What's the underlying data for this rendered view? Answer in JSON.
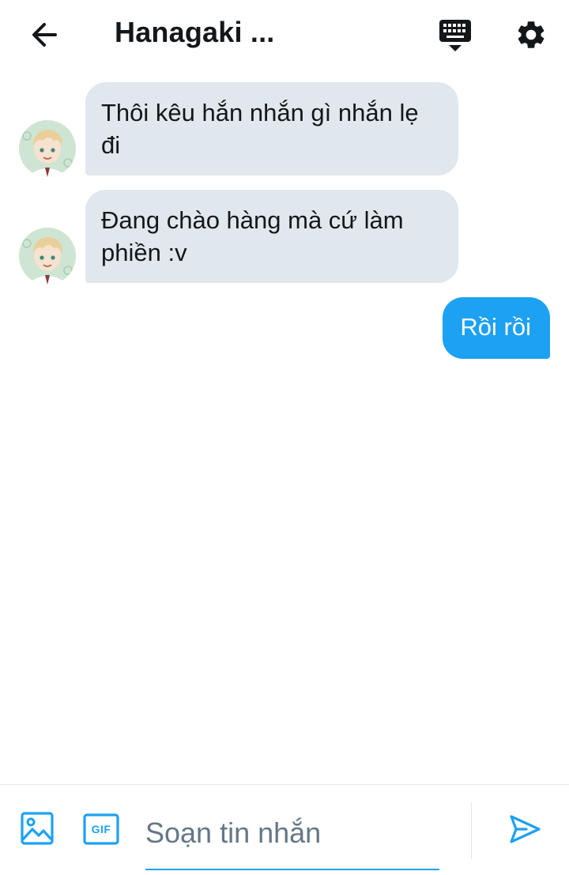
{
  "header": {
    "title": "Hanagaki ...",
    "back_icon": "arrow-left-icon",
    "keyboard_icon": "keyboard-icon",
    "settings_icon": "gear-icon"
  },
  "messages": [
    {
      "direction": "incoming",
      "text": "Thôi kêu hắn nhắn gì nhắn lẹ đi",
      "avatar": "avatar"
    },
    {
      "direction": "incoming",
      "text": "Đang chào hàng mà cứ làm phiền :v",
      "avatar": "avatar"
    },
    {
      "direction": "outgoing",
      "text": "Rồi rồi"
    }
  ],
  "composer": {
    "placeholder": "Soạn tin nhắn",
    "value": "",
    "image_icon": "image-icon",
    "gif_label": "GIF",
    "send_icon": "send-icon"
  },
  "colors": {
    "accent": "#1da1f2",
    "incoming_bubble": "#e1e8ed",
    "text": "#14171a",
    "placeholder": "#657786"
  }
}
